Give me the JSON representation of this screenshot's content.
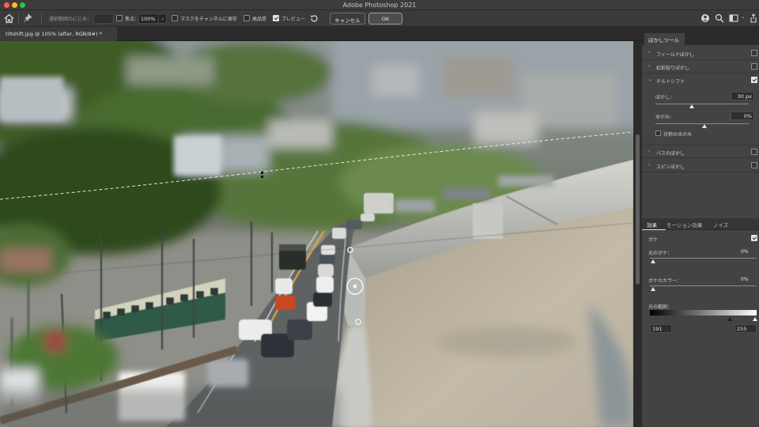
{
  "app": {
    "title": "Adobe Photoshop 2021"
  },
  "options_bar": {
    "feather_label": "選択範囲のにじみ：",
    "focus_label": "焦点：",
    "focus_value": "100%",
    "save_mask_label": "マスクをチャンネルに保存",
    "save_mask_checked": false,
    "high_quality_label": "高品質",
    "high_quality_checked": false,
    "preview_label": "プレビュー",
    "preview_checked": true,
    "cancel_label": "キャンセル",
    "ok_label": "OK"
  },
  "document": {
    "tab_label": "tiltshift.jpg @ 105% (after, RGB/8#) *"
  },
  "blur_panel": {
    "tab_label": "ぼかしツール",
    "sections": [
      {
        "label": "フィールドぼかし",
        "expanded": false,
        "checked": false
      },
      {
        "label": "虹彩絞りぼかし",
        "expanded": false,
        "checked": false
      },
      {
        "label": "チルトシフト",
        "expanded": true,
        "checked": true
      },
      {
        "label": "パスのぼかし",
        "expanded": false,
        "checked": false
      },
      {
        "label": "スピンぼかし",
        "expanded": false,
        "checked": false
      }
    ],
    "tilt_shift": {
      "blur_label": "ぼかし：",
      "blur_value": "30 px",
      "blur_slider_level": 0.3,
      "distortion_label": "ゆがみ：",
      "distortion_value": "0%",
      "distortion_slider_level": 0.5,
      "symmetric_label": "対称のゆがみ",
      "symmetric_checked": false
    }
  },
  "effects_panel": {
    "tabs": [
      "効果",
      "モーション効果",
      "ノイズ"
    ],
    "bokeh_label": "ボケ",
    "bokeh_checked": true,
    "light_bokeh_label": "光のボケ：",
    "light_bokeh_value": "0%",
    "bokeh_color_label": "ボケのカラー：",
    "bokeh_color_value": "0%",
    "light_range_label": "光の範囲：",
    "light_range_min": "191",
    "light_range_max": "255"
  }
}
